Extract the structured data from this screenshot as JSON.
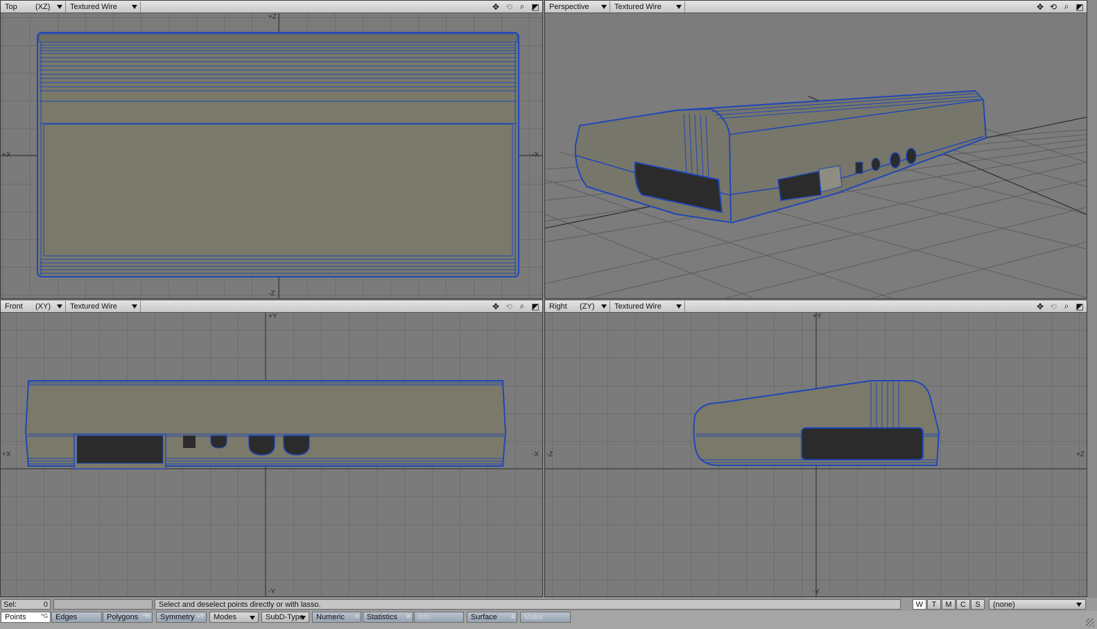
{
  "viewports": {
    "top": {
      "view": "Top",
      "axes": "(XZ)",
      "mode": "Textured Wire",
      "labels": {
        "top": "+Z",
        "bottom": "-Z",
        "left": "+X",
        "right": "-X"
      }
    },
    "perspective": {
      "view": "Perspective",
      "mode": "Textured Wire"
    },
    "front": {
      "view": "Front",
      "axes": "(XY)",
      "mode": "Textured Wire",
      "labels": {
        "top": "+Y",
        "bottom": "-Y",
        "left": "+X",
        "right": "-X"
      }
    },
    "right": {
      "view": "Right",
      "axes": "(ZY)",
      "mode": "Textured Wire",
      "labels": {
        "top": "+Y",
        "bottom": "-Y",
        "left": "-Z",
        "right": "+Z"
      }
    }
  },
  "status": {
    "sel_label": "Sel:",
    "sel_count": "0",
    "hint": "Select and deselect points directly or with lasso.",
    "wtmcs": [
      "W",
      "T",
      "M",
      "C",
      "S"
    ],
    "surface_select": "(none)"
  },
  "modebar": {
    "points": "Points",
    "points_key": "^G",
    "edges": "Edges",
    "polygons": "Polygons",
    "polygons_key": "^H",
    "symmetry": "Symmetry",
    "symmetry_key": "+Y",
    "modes": "Modes",
    "subd": "SubD-Type",
    "numeric": "Numeric",
    "numeric_key": "n",
    "statistics": "Statistics",
    "statistics_key": "w",
    "info": "Info",
    "surface": "Surface",
    "surface_key": "q",
    "make": "Make"
  },
  "colors": {
    "wire": "#1f47b8",
    "surface": "#787768",
    "grid": "#5f5f5f",
    "port": "#2b2b2b"
  }
}
